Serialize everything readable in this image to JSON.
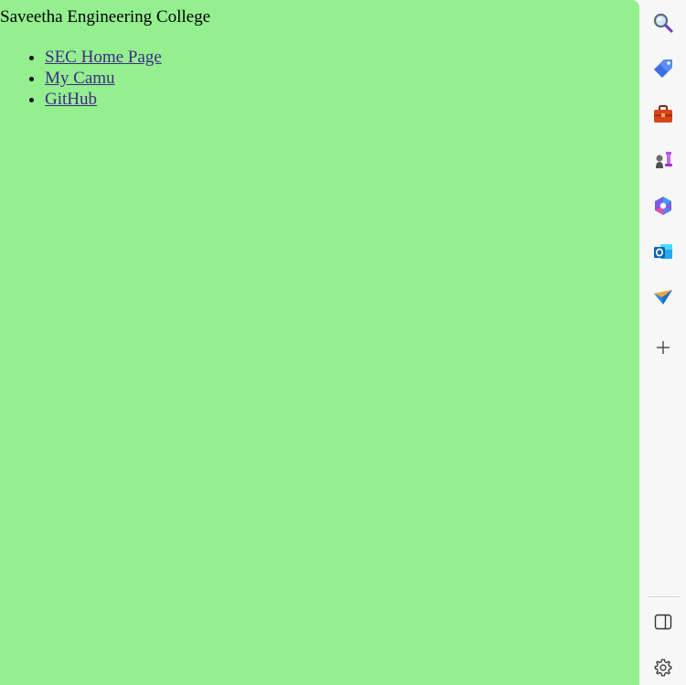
{
  "page": {
    "background_color": "#94ef8f",
    "title": "Saveetha Engineering College",
    "links": [
      {
        "label": "SEC Home Page"
      },
      {
        "label": "My Camu"
      },
      {
        "label": "GitHub"
      }
    ],
    "link_color": "#3f2b84"
  },
  "sidebar": {
    "top_icons": [
      {
        "name": "search-icon"
      },
      {
        "name": "shopping-tag-icon"
      },
      {
        "name": "toolbox-icon"
      },
      {
        "name": "games-icon"
      },
      {
        "name": "copilot-icon"
      },
      {
        "name": "outlook-icon"
      },
      {
        "name": "send-drop-icon"
      },
      {
        "name": "add-icon"
      }
    ],
    "bottom_icons": [
      {
        "name": "hide-sidebar-icon"
      },
      {
        "name": "settings-gear-icon"
      }
    ]
  }
}
